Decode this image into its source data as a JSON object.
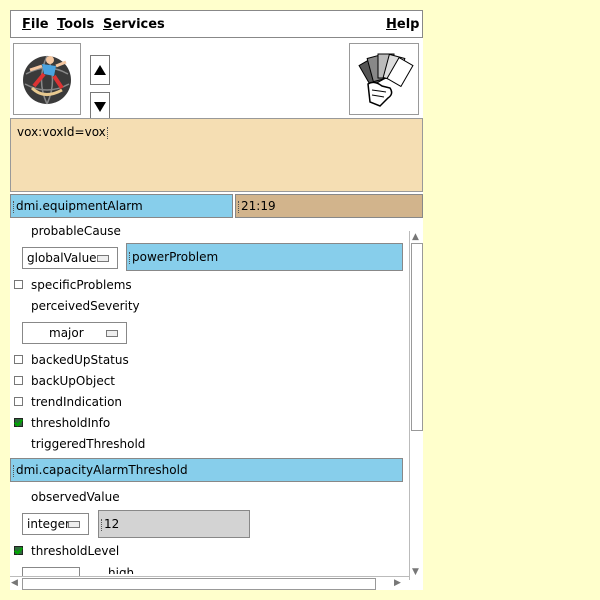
{
  "menubar": {
    "file": "File",
    "tools": "Tools",
    "services": "Services",
    "help": "Help"
  },
  "icons": {
    "left": "globe-logo-icon",
    "up": "arrow-up-icon",
    "down": "arrow-down-icon",
    "right": "hand-cards-icon"
  },
  "command": {
    "text": "vox:voxId=vox"
  },
  "alarm": {
    "title": "dmi.equipmentAlarm",
    "time": "21:19"
  },
  "fields": {
    "probableCause": "probableCause",
    "probableCause_type": "globalValue",
    "probableCause_value": "powerProblem",
    "specificProblems": "specificProblems",
    "perceivedSeverity": "perceivedSeverity",
    "perceivedSeverity_value": "major",
    "backedUpStatus": "backedUpStatus",
    "backUpObject": "backUpObject",
    "trendIndication": "trendIndication",
    "thresholdInfo": "thresholdInfo",
    "triggeredThreshold": "triggeredThreshold",
    "threshold_title": "dmi.capacityAlarmThreshold",
    "observedValue": "observedValue",
    "observedValue_type": "integer",
    "observedValue_value": "12",
    "thresholdLevel": "thresholdLevel",
    "partial_next": "high"
  },
  "checks": {
    "specificProblems": false,
    "backedUpStatus": false,
    "backUpObject": false,
    "trendIndication": false,
    "thresholdInfo": true,
    "thresholdLevel": true
  },
  "colors": {
    "background": "#FFFFCC",
    "command_bg": "#F5DEB3",
    "title_blue": "#87CEEB",
    "time_tan": "#D2B48C",
    "value_grey": "#D3D3D3"
  }
}
